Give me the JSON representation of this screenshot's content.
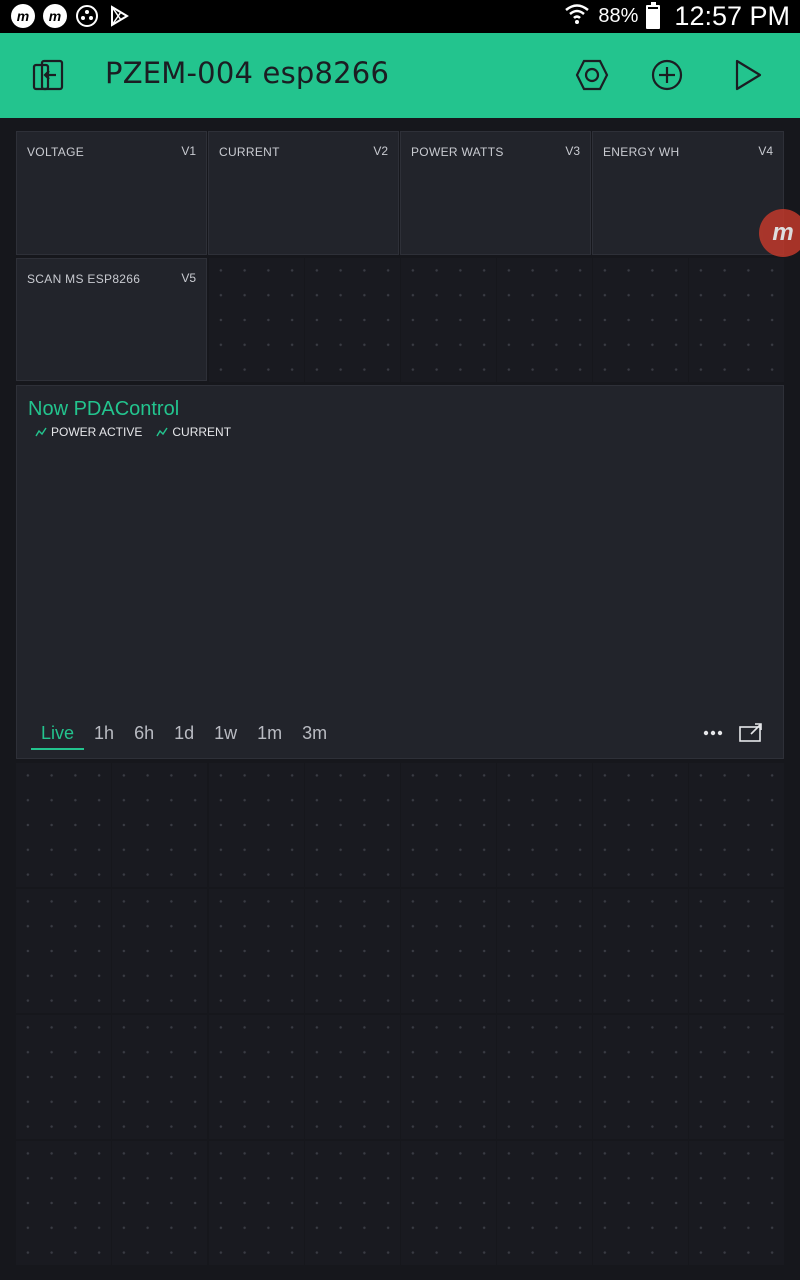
{
  "status_bar": {
    "battery_percent": "88%",
    "battery_level": 0.88,
    "time": "12:57 PM",
    "icons": [
      "m-app-icon",
      "m-app-icon",
      "circle-dots-icon",
      "play-store-icon",
      "wifi-icon",
      "battery-icon"
    ]
  },
  "toolbar": {
    "title": "PZEM-004 esp8266",
    "icons": [
      "back-exit-icon",
      "settings-hex-icon",
      "add-icon",
      "play-icon"
    ],
    "accent": "#23c48e"
  },
  "widgets": [
    {
      "label": "VOLTAGE",
      "pin": "V1"
    },
    {
      "label": "CURRENT",
      "pin": "V2"
    },
    {
      "label": "POWER WATTS",
      "pin": "V3"
    },
    {
      "label": "ENERGY WH",
      "pin": "V4"
    },
    {
      "label": "SCAN MS ESP8266",
      "pin": "V5"
    }
  ],
  "chart": {
    "title": "Now PDAControl",
    "legend": [
      "POWER ACTIVE",
      "CURRENT"
    ],
    "periods": [
      "Live",
      "1h",
      "6h",
      "1d",
      "1w",
      "1m",
      "3m"
    ],
    "active_period": "Live"
  },
  "floating_button": {
    "label": "m"
  }
}
